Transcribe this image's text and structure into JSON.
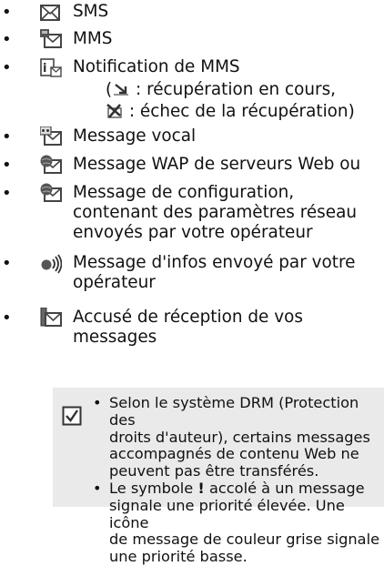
{
  "items": [
    {
      "icon": "envelope-icon",
      "lines": [
        "SMS"
      ]
    },
    {
      "icon": "mms-envelope-icon",
      "lines": [
        "MMS"
      ]
    },
    {
      "icon": "mms-notification-icon",
      "lines": [
        "Notification de MMS"
      ]
    },
    {
      "icon": "voicemail-envelope-icon",
      "lines": [
        "Message vocal"
      ]
    },
    {
      "icon": "wap-envelope-icon",
      "lines": [
        "Message WAP de serveurs Web ou"
      ]
    },
    {
      "icon": "config-envelope-icon",
      "lines": [
        "Message de configuration,",
        "contenant des paramètres réseau",
        "envoyés par votre opérateur"
      ]
    },
    {
      "icon": "broadcast-icon",
      "lines": [
        "Message d'infos envoyé par votre",
        "opérateur"
      ]
    },
    {
      "icon": "receipt-envelope-icon",
      "lines": [
        "Accusé de réception de vos",
        "messages"
      ]
    }
  ],
  "mms_sub": {
    "line1_prefix": "(",
    "line1_text": " : récupération en cours,",
    "line2_text": " : échec de la récupération)"
  },
  "note": {
    "icon": "checkbox-icon",
    "bullets": [
      {
        "lines": [
          "Selon le système DRM (Protection des",
          "droits d'auteur), certains messages",
          "accompagnés de contenu Web ne",
          "peuvent pas être transférés."
        ]
      },
      {
        "lines": [
          "Le symbole ! accolé à un message",
          "signale une priorité élevée. Une icône",
          "de message de couleur grise signale",
          "une priorité basse."
        ]
      }
    ]
  }
}
